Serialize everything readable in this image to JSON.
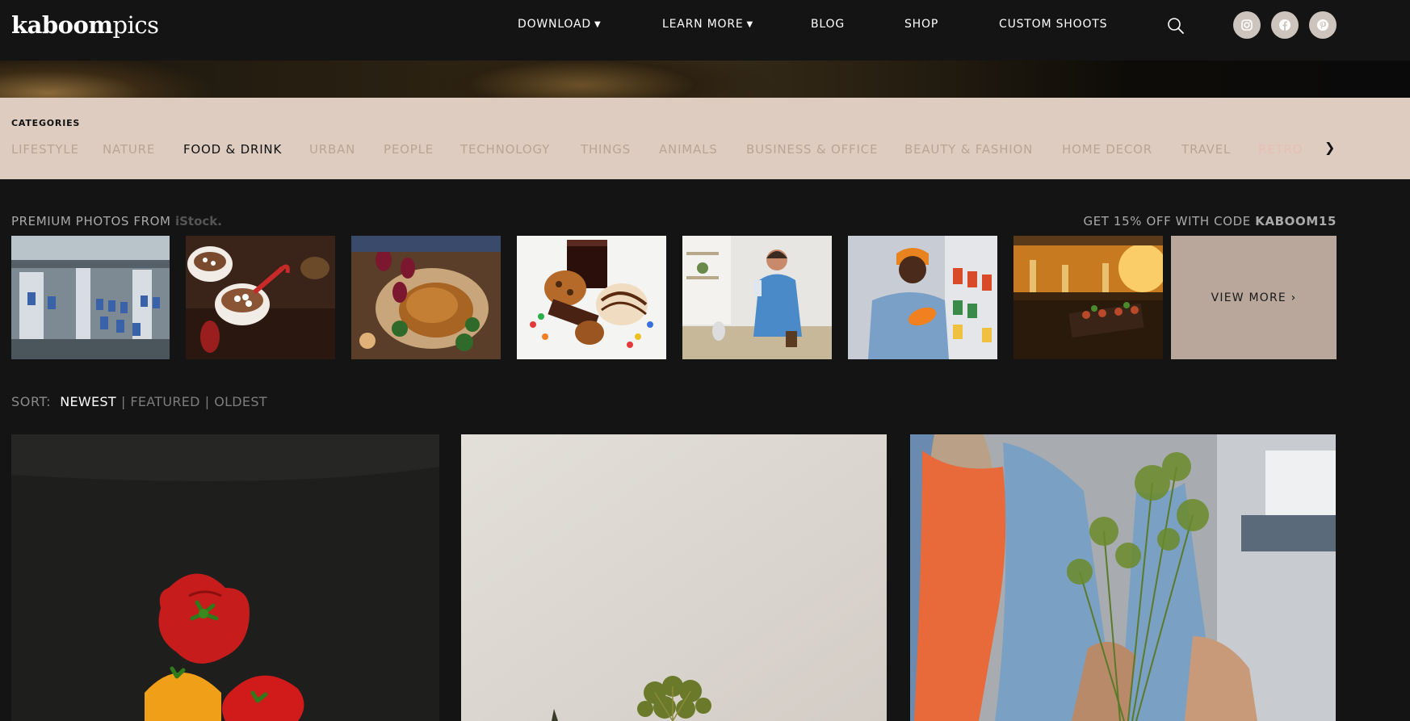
{
  "header": {
    "logo_bold": "kaboom",
    "logo_light": "pics",
    "nav": [
      {
        "label": "DOWNLOAD",
        "has_caret": true
      },
      {
        "label": "LEARN MORE",
        "has_caret": true
      },
      {
        "label": "BLOG",
        "has_caret": false
      },
      {
        "label": "SHOP",
        "has_caret": false
      },
      {
        "label": "CUSTOM SHOOTS",
        "has_caret": false
      }
    ],
    "social_icons": [
      "instagram-icon",
      "facebook-icon",
      "pinterest-icon"
    ],
    "search_icon": "search-icon"
  },
  "categories": {
    "title": "CATEGORIES",
    "items": [
      "LIFESTYLE",
      "NATURE",
      "FOOD & DRINK",
      "URBAN",
      "PEOPLE",
      "TECHNOLOGY",
      "THINGS",
      "ANIMALS",
      "BUSINESS & OFFICE",
      "BEAUTY & FASHION",
      "HOME DECOR",
      "TRAVEL",
      "RETRO"
    ],
    "active": "FOOD & DRINK"
  },
  "premium": {
    "label": "PREMIUM PHOTOS FROM",
    "brand": "iStock.",
    "promo_text": "GET 15% OFF WITH CODE",
    "promo_code": "KABOOM15",
    "view_more": "VIEW MORE ›",
    "thumbnails": [
      "dairy-factory-bottles",
      "hot-chocolate-marshmallows",
      "thanksgiving-turkey-toast",
      "cookies-donut-cola",
      "woman-kitchen-drink",
      "man-supermarket-juice",
      "bar-sunset-food"
    ]
  },
  "sort": {
    "label": "SORT:",
    "options": [
      "NEWEST",
      "FEATURED",
      "OLDEST"
    ],
    "active": "NEWEST"
  },
  "gallery": [
    "red-and-yellow-tomatoes",
    "dill-flower-vase",
    "woman-holding-dill-bouquet"
  ],
  "colors": {
    "background": "#141414",
    "category_bar": "#ddccbf",
    "category_muted": "#b8a597",
    "view_more_bg": "#b8a79a",
    "social_bg": "#ccc4bd"
  }
}
